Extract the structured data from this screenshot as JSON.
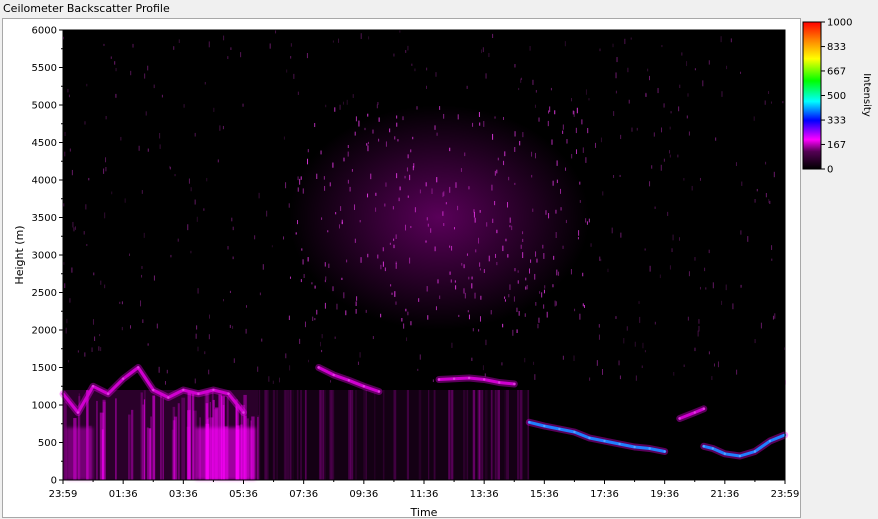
{
  "title": "Ceilometer Backscatter Profile",
  "chart_data": {
    "type": "heatmap",
    "title": "Ceilometer Backscatter Profile",
    "xlabel": "Time",
    "ylabel": "Height (m)",
    "colorbar_label": "Intensity",
    "x_ticks": [
      "23:59",
      "01:36",
      "03:36",
      "05:36",
      "07:36",
      "09:36",
      "11:36",
      "13:36",
      "15:36",
      "17:36",
      "19:36",
      "21:36",
      "23:59"
    ],
    "y_ticks": [
      0,
      500,
      1000,
      1500,
      2000,
      2500,
      3000,
      3500,
      4000,
      4500,
      5000,
      5500,
      6000
    ],
    "ylim": [
      0,
      6000
    ],
    "color_ticks": [
      1000,
      833,
      667,
      500,
      333,
      167,
      0
    ],
    "color_ticks_labels": [
      "1000",
      "833",
      "667",
      "500",
      "333",
      "167",
      "0"
    ],
    "color_range": [
      0,
      1000
    ],
    "colormap_stops": [
      "#000000",
      "#cc00cc",
      "#ff00ff",
      "#0000ff",
      "#00ffff",
      "#00ff00",
      "#ffff00",
      "#ff8000",
      "#ff0000"
    ],
    "layers": [
      {
        "name": "layer-1",
        "x_hours": [
          0.0,
          0.5,
          1.0,
          1.5,
          2.0,
          2.5,
          3.0,
          3.5,
          4.0,
          4.5,
          5.0,
          5.5,
          6.0
        ],
        "height_m": [
          1150,
          900,
          1250,
          1150,
          1350,
          1500,
          1200,
          1100,
          1200,
          1150,
          1200,
          1150,
          900
        ],
        "intensity": 200
      },
      {
        "name": "layer-2",
        "x_hours": [
          8.5,
          9.0,
          9.5,
          10.0,
          10.5
        ],
        "height_m": [
          1500,
          1400,
          1330,
          1250,
          1180
        ],
        "intensity": 180
      },
      {
        "name": "layer-3",
        "x_hours": [
          12.5,
          13.0,
          13.5,
          14.0,
          14.5,
          15.0
        ],
        "height_m": [
          1340,
          1350,
          1360,
          1340,
          1300,
          1280
        ],
        "intensity": 200
      },
      {
        "name": "layer-4",
        "x_hours": [
          15.5,
          16.0,
          16.5,
          17.0,
          17.5,
          18.0,
          18.5,
          19.0,
          19.5,
          20.0
        ],
        "height_m": [
          770,
          720,
          680,
          640,
          560,
          520,
          480,
          440,
          420,
          380
        ],
        "intensity": 420
      },
      {
        "name": "layer-5",
        "x_hours": [
          21.3,
          21.6,
          22.0,
          22.5,
          23.0,
          23.5,
          23.99
        ],
        "height_m": [
          450,
          420,
          350,
          320,
          380,
          520,
          600
        ],
        "intensity": 450
      },
      {
        "name": "layer-6",
        "x_hours": [
          20.5,
          21.0,
          21.3
        ],
        "height_m": [
          820,
          900,
          950
        ],
        "intensity": 180
      }
    ],
    "noise_region": {
      "x_hours": [
        7.5,
        17.5
      ],
      "height_m": [
        2000,
        5000
      ],
      "intensity": 120
    },
    "ground_region": {
      "x_hours": [
        0.0,
        6.5
      ],
      "height_m": [
        0,
        1200
      ],
      "intensity": 250
    }
  }
}
